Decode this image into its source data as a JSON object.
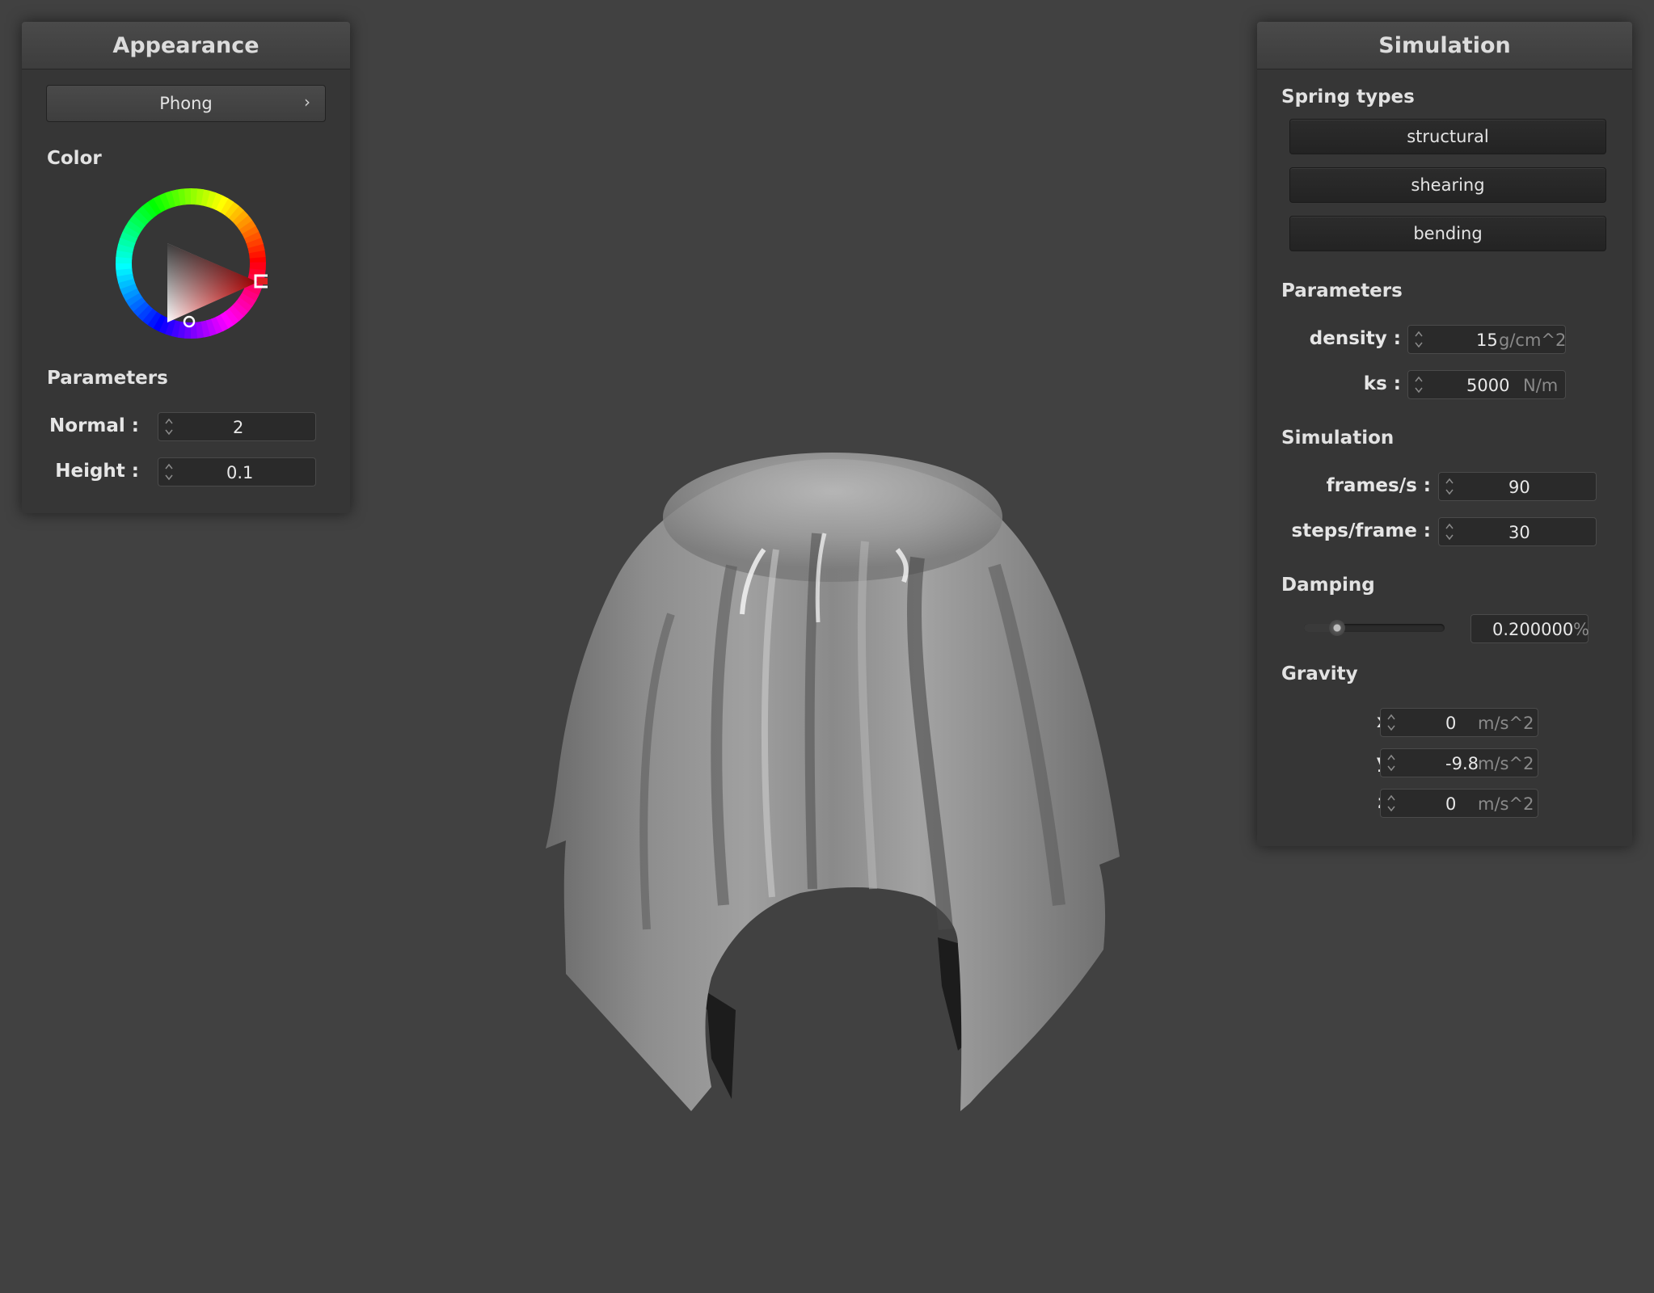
{
  "appearance": {
    "title": "Appearance",
    "shader_select": "Phong",
    "color_label": "Color",
    "color_picker": {
      "hue_color": "#ff0000"
    },
    "parameters_label": "Parameters",
    "normal_label": "Normal :",
    "normal_value": "2",
    "height_label": "Height :",
    "height_value": "0.1"
  },
  "simulation": {
    "title": "Simulation",
    "spring_types_label": "Spring types",
    "spring_buttons": [
      "structural",
      "shearing",
      "bending"
    ],
    "parameters_label": "Parameters",
    "density_label": "density :",
    "density_value": "15",
    "density_unit": "g/cm^2",
    "ks_label": "ks :",
    "ks_value": "5000",
    "ks_unit": "N/m",
    "simulation_label": "Simulation",
    "fps_label": "frames/s :",
    "fps_value": "90",
    "steps_label": "steps/frame :",
    "steps_value": "30",
    "damping_label": "Damping",
    "damping_value": "0.200000",
    "damping_unit": "%",
    "damping_slider_level": 0.2,
    "gravity_label": "Gravity",
    "gx_label": "x :",
    "gx_value": "0",
    "gy_label": "y :",
    "gy_value": "-9.8",
    "gz_label": "z :",
    "gz_value": "0",
    "gravity_unit": "m/s^2"
  },
  "colors": {
    "background": "#414141",
    "panel": "#363636",
    "cloth": "#8c8c8c"
  }
}
